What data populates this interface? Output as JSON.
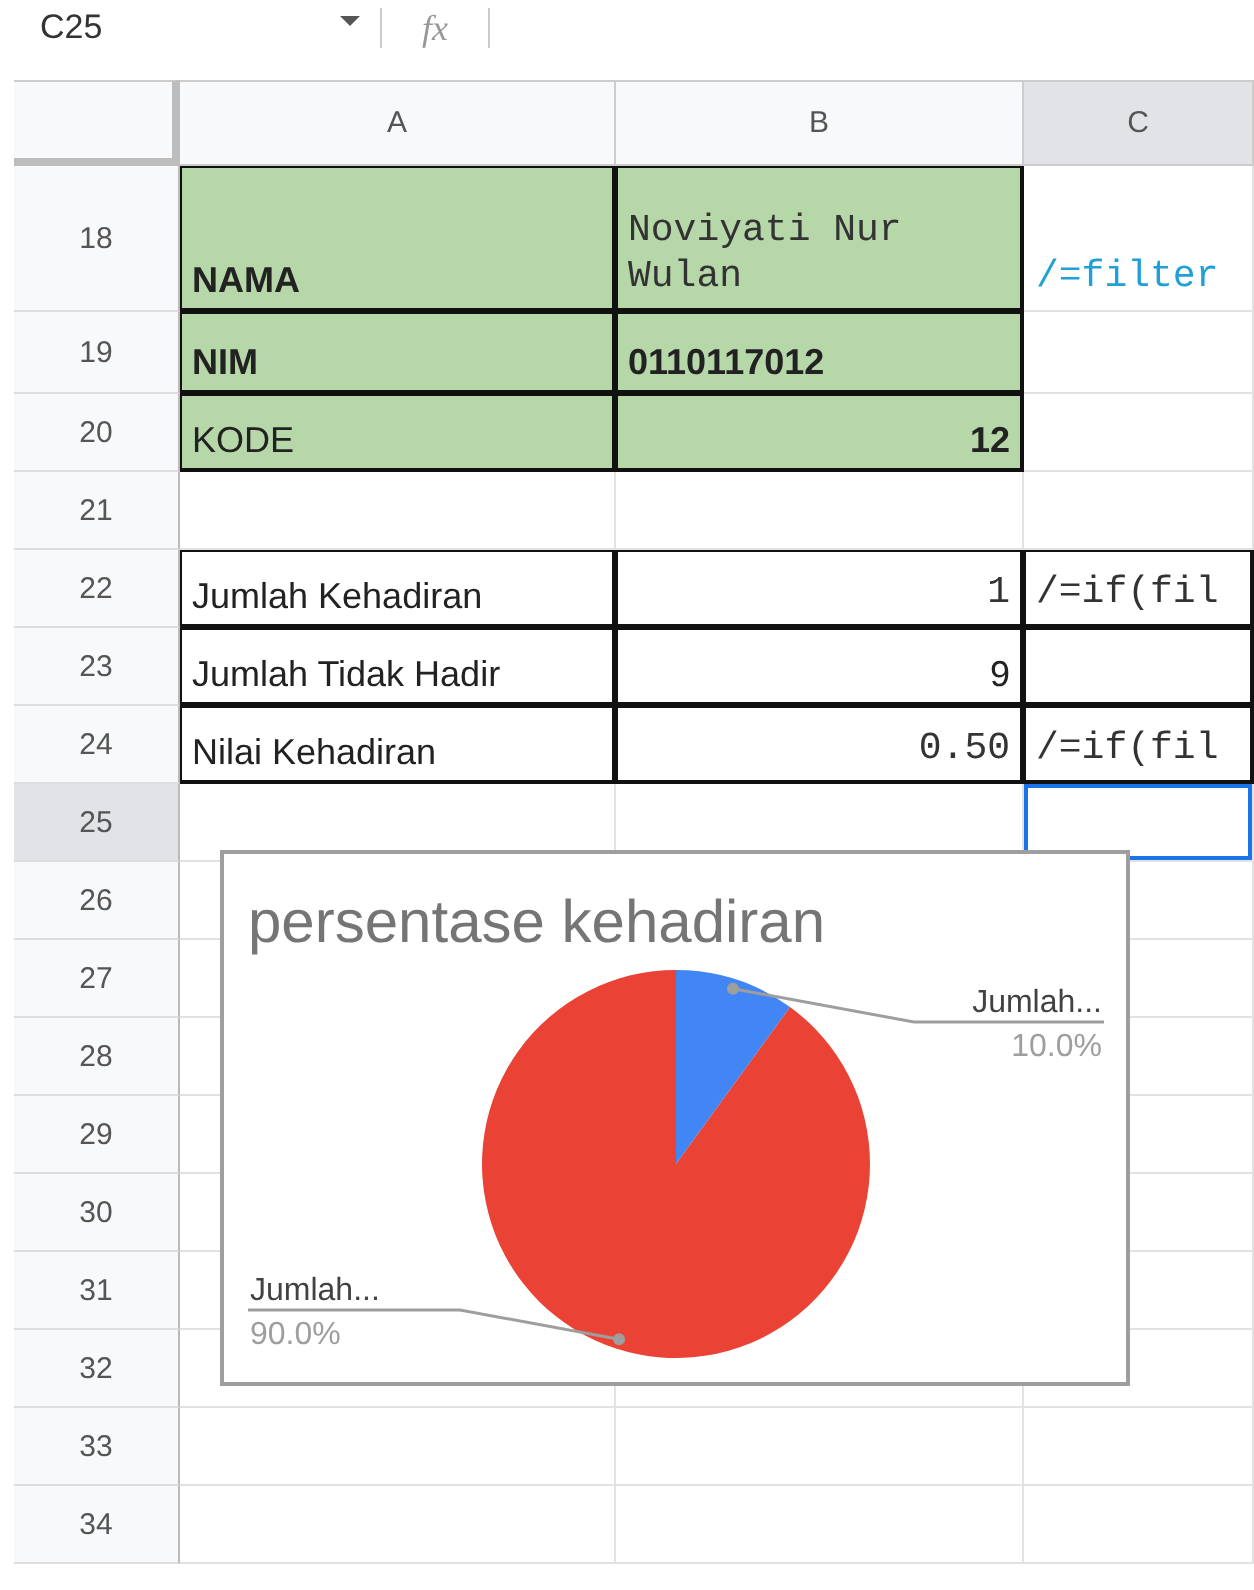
{
  "toolbar": {
    "name_box": "C25",
    "formula_label": "fx"
  },
  "columns": [
    {
      "label": "A",
      "selected": false
    },
    {
      "label": "B",
      "selected": false
    },
    {
      "label": "C",
      "selected": true
    }
  ],
  "rows": [
    {
      "number": "18",
      "selected": false,
      "cells": [
        {
          "text": "NAMA",
          "bold": true,
          "mono": false,
          "align_right": false,
          "fill": true,
          "boxed": true
        },
        {
          "text": "Noviyati Nur Wulan",
          "bold": false,
          "mono": true,
          "align_right": false,
          "fill": true,
          "boxed": true
        },
        {
          "text": "/=filter",
          "bold": false,
          "mono": true,
          "align_right": false,
          "link": true
        }
      ]
    },
    {
      "number": "19",
      "selected": false,
      "cells": [
        {
          "text": "NIM",
          "bold": true,
          "mono": false,
          "align_right": false,
          "fill": true,
          "boxed": true
        },
        {
          "text": "0110117012",
          "bold": true,
          "mono": false,
          "align_right": false,
          "fill": true,
          "boxed": true
        },
        {}
      ]
    },
    {
      "number": "20",
      "selected": false,
      "cells": [
        {
          "text": "KODE",
          "bold": false,
          "mono": false,
          "align_right": false,
          "fill": true,
          "boxed": true
        },
        {
          "text": "12",
          "bold": true,
          "mono": false,
          "align_right": true,
          "fill": true,
          "boxed": true
        },
        {}
      ]
    },
    {
      "number": "21",
      "selected": false,
      "cells": [
        {},
        {},
        {}
      ]
    },
    {
      "number": "22",
      "selected": false,
      "cells": [
        {
          "text": "Jumlah Kehadiran",
          "bold": false,
          "mono": false,
          "align_right": false,
          "boxed": true
        },
        {
          "text": "1",
          "bold": false,
          "mono": true,
          "align_right": true,
          "boxed": true
        },
        {
          "text": "/=if(fil",
          "bold": false,
          "mono": true,
          "align_right": false,
          "boxed": true
        }
      ]
    },
    {
      "number": "23",
      "selected": false,
      "cells": [
        {
          "text": "Jumlah Tidak Hadir",
          "bold": false,
          "mono": false,
          "align_right": false,
          "boxed": true
        },
        {
          "text": "9",
          "bold": false,
          "mono": false,
          "align_right": true,
          "boxed": true
        },
        {
          "boxed": true
        }
      ]
    },
    {
      "number": "24",
      "selected": false,
      "cells": [
        {
          "text": "Nilai Kehadiran",
          "bold": false,
          "mono": false,
          "align_right": false,
          "boxed": true
        },
        {
          "text": "0.50",
          "bold": false,
          "mono": true,
          "align_right": true,
          "boxed": true
        },
        {
          "text": "/=if(fil",
          "bold": false,
          "mono": true,
          "align_right": false,
          "boxed": true
        }
      ]
    },
    {
      "number": "25",
      "selected": true,
      "cells": [
        {},
        {},
        {
          "active": true
        }
      ]
    },
    {
      "number": "26",
      "selected": false,
      "cells": [
        {},
        {},
        {}
      ]
    },
    {
      "number": "27",
      "selected": false,
      "cells": [
        {},
        {},
        {}
      ]
    },
    {
      "number": "28",
      "selected": false,
      "cells": [
        {},
        {},
        {}
      ]
    },
    {
      "number": "29",
      "selected": false,
      "cells": [
        {},
        {},
        {}
      ]
    },
    {
      "number": "30",
      "selected": false,
      "cells": [
        {},
        {},
        {}
      ]
    },
    {
      "number": "31",
      "selected": false,
      "cells": [
        {},
        {},
        {}
      ]
    },
    {
      "number": "32",
      "selected": false,
      "cells": [
        {},
        {},
        {}
      ]
    },
    {
      "number": "33",
      "selected": false,
      "cells": [
        {},
        {},
        {}
      ]
    },
    {
      "number": "34",
      "selected": false,
      "cells": [
        {},
        {},
        {}
      ]
    }
  ],
  "chart": {
    "chart_data": {
      "type": "pie",
      "title": "persentase kehadiran",
      "categories": [
        "Jumlah...",
        "Jumlah..."
      ],
      "values": [
        10,
        90
      ],
      "colors": [
        "#4285f4",
        "#ea4335"
      ],
      "value_labels": [
        "10.0%",
        "90.0%"
      ]
    }
  }
}
